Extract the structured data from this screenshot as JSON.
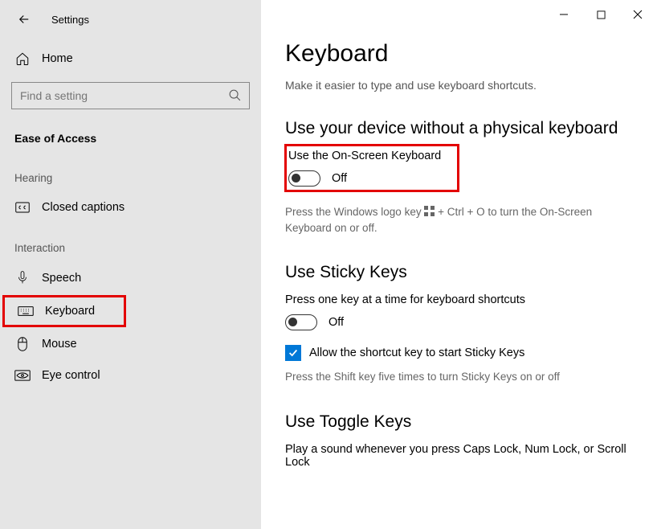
{
  "window": {
    "title": "Settings"
  },
  "sidebar": {
    "home": "Home",
    "search_placeholder": "Find a setting",
    "category": "Ease of Access",
    "groups": [
      {
        "name": "Hearing",
        "items": [
          {
            "id": "closed-captions",
            "label": "Closed captions"
          }
        ]
      },
      {
        "name": "Interaction",
        "items": [
          {
            "id": "speech",
            "label": "Speech"
          },
          {
            "id": "keyboard",
            "label": "Keyboard"
          },
          {
            "id": "mouse",
            "label": "Mouse"
          },
          {
            "id": "eye-control",
            "label": "Eye control"
          }
        ]
      }
    ]
  },
  "main": {
    "heading": "Keyboard",
    "subtitle": "Make it easier to type and use keyboard shortcuts.",
    "sections": {
      "no_physical": {
        "title": "Use your device without a physical keyboard",
        "toggle_label": "Use the On-Screen Keyboard",
        "toggle_state": "Off",
        "help_pre": "Press the Windows logo key ",
        "help_post": " + Ctrl + O to turn the On-Screen Keyboard on or off."
      },
      "sticky": {
        "title": "Use Sticky Keys",
        "desc": "Press one key at a time for keyboard shortcuts",
        "toggle_state": "Off",
        "checkbox_label": "Allow the shortcut key to start Sticky Keys",
        "help": "Press the Shift key five times to turn Sticky Keys on or off"
      },
      "toggle_keys": {
        "title": "Use Toggle Keys",
        "desc": "Play a sound whenever you press Caps Lock, Num Lock, or Scroll Lock"
      }
    }
  }
}
